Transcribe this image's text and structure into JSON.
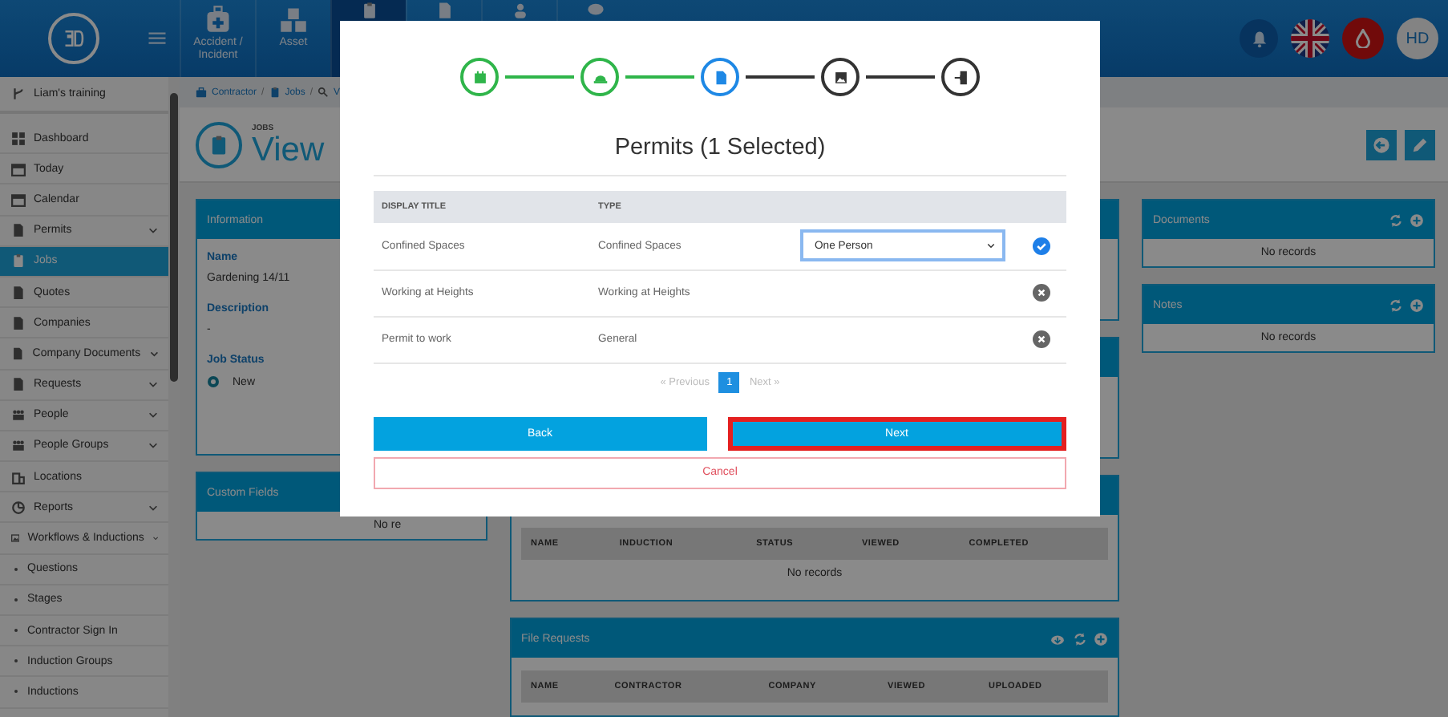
{
  "topbar": {
    "tiles": [
      {
        "label": "Accident / Incident",
        "selected": false
      },
      {
        "label": "Asset",
        "selected": false
      },
      {
        "selected": true
      },
      {
        "selected": false
      },
      {
        "selected": false
      },
      {
        "selected": false
      }
    ],
    "user_initials": "HD"
  },
  "sidebar": {
    "items": [
      {
        "label": "Liam's training",
        "kind": "org",
        "expandable": false,
        "selected": false
      },
      {
        "label": "Dashboard",
        "kind": "item",
        "expandable": false,
        "selected": false
      },
      {
        "label": "Today",
        "kind": "item",
        "expandable": false,
        "selected": false
      },
      {
        "label": "Calendar",
        "kind": "item",
        "expandable": false,
        "selected": false
      },
      {
        "label": "Permits",
        "kind": "item",
        "expandable": true,
        "selected": false
      },
      {
        "label": "Jobs",
        "kind": "item",
        "expandable": false,
        "selected": true
      },
      {
        "label": "Quotes",
        "kind": "item",
        "expandable": false,
        "selected": false
      },
      {
        "label": "Companies",
        "kind": "item",
        "expandable": false,
        "selected": false
      },
      {
        "label": "Company Documents",
        "kind": "item",
        "expandable": true,
        "selected": false
      },
      {
        "label": "Requests",
        "kind": "item",
        "expandable": true,
        "selected": false
      },
      {
        "label": "People",
        "kind": "item",
        "expandable": true,
        "selected": false
      },
      {
        "label": "People Groups",
        "kind": "item",
        "expandable": true,
        "selected": false
      },
      {
        "label": "Locations",
        "kind": "item",
        "expandable": false,
        "selected": false
      },
      {
        "label": "Reports",
        "kind": "item",
        "expandable": true,
        "selected": false
      },
      {
        "label": "Workflows & Inductions",
        "kind": "item",
        "expandable": true,
        "selected": false
      },
      {
        "label": "Questions",
        "kind": "subitem",
        "expandable": false,
        "selected": false
      },
      {
        "label": "Stages",
        "kind": "subitem",
        "expandable": false,
        "selected": false
      },
      {
        "label": "Contractor Sign In",
        "kind": "subitem",
        "expandable": false,
        "selected": false
      },
      {
        "label": "Induction Groups",
        "kind": "subitem",
        "expandable": false,
        "selected": false
      },
      {
        "label": "Inductions",
        "kind": "subitem",
        "expandable": false,
        "selected": false
      }
    ]
  },
  "breadcrumb": [
    {
      "kind": "link",
      "text": "Contractor"
    },
    {
      "kind": "separator",
      "text": "/"
    },
    {
      "kind": "link",
      "text": "Jobs"
    },
    {
      "kind": "separator",
      "text": "/"
    },
    {
      "kind": "link",
      "text": "V"
    }
  ],
  "page_header": {
    "kicker": "JOBS",
    "title": "View"
  },
  "information": {
    "title": "Information",
    "fields": [
      {
        "label": "Name",
        "value": "Gardening 14/11"
      },
      {
        "label": "Description",
        "value": "-"
      }
    ],
    "job_status": {
      "label": "Job Status",
      "value": "New"
    }
  },
  "custom_fields": {
    "title": "Custom Fields",
    "body": "No re"
  },
  "inductions_table": {
    "columns": [
      "NAME",
      "INDUCTION",
      "STATUS",
      "VIEWED",
      "COMPLETED"
    ],
    "empty": "No records"
  },
  "file_requests": {
    "title": "File Requests",
    "columns": [
      "NAME",
      "CONTRACTOR",
      "COMPANY",
      "VIEWED",
      "UPLOADED"
    ]
  },
  "documents": {
    "title": "Documents",
    "empty": "No records"
  },
  "notes": {
    "title": "Notes",
    "empty": "No records"
  },
  "modal": {
    "steps": [
      {
        "done": true,
        "current": false
      },
      {
        "done": true,
        "current": false
      },
      {
        "done": false,
        "current": true
      },
      {
        "done": false,
        "current": false
      },
      {
        "done": false,
        "current": false
      }
    ],
    "title": "Permits (1 Selected)",
    "columns": [
      "DISPLAY TITLE",
      "TYPE"
    ],
    "rows": [
      {
        "title": "Confined Spaces",
        "type": "Confined Spaces",
        "selected": true,
        "option": "One Person"
      },
      {
        "title": "Working at Heights",
        "type": "Working at Heights",
        "selected": false
      },
      {
        "title": "Permit to work",
        "type": "General",
        "selected": false
      }
    ],
    "pagination": {
      "previous": "« Previous",
      "page": "1",
      "next": "Next »"
    },
    "back": "Back",
    "next": {
      "label": "Next",
      "focused": true
    },
    "cancel": "Cancel"
  }
}
